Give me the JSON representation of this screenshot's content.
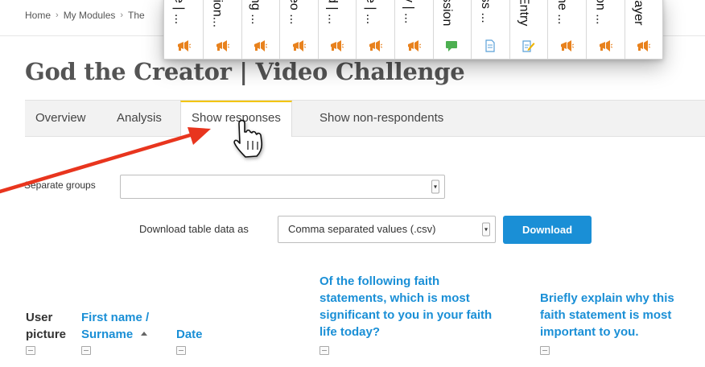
{
  "breadcrumb": [
    "Home",
    "My Modules",
    "The"
  ],
  "page_title": "God the Creator | Video Challenge",
  "popup_columns": [
    {
      "label": "e | ...",
      "icon": "megaphone-icon",
      "color": "#e8821e"
    },
    {
      "label": "tion...",
      "icon": "megaphone-icon",
      "color": "#e8821e"
    },
    {
      "label": "ng ...",
      "icon": "megaphone-icon",
      "color": "#e8821e"
    },
    {
      "label": "eo ...",
      "icon": "megaphone-icon",
      "color": "#e8821e"
    },
    {
      "label": "d | ...",
      "icon": "megaphone-icon",
      "color": "#e8821e"
    },
    {
      "label": "e | ...",
      "icon": "megaphone-icon",
      "color": "#e8821e"
    },
    {
      "label": "y | ...",
      "icon": "megaphone-icon",
      "color": "#e8821e"
    },
    {
      "label": "ssion",
      "icon": "chat-icon",
      "color": "#4caf50"
    },
    {
      "label": "ss ...",
      "icon": "document-icon",
      "color": "#5aa0d8"
    },
    {
      "label": "Entry",
      "icon": "edit-page-icon",
      "color": "#5aa0d8"
    },
    {
      "label": "he ...",
      "icon": "megaphone-icon",
      "color": "#e8821e"
    },
    {
      "label": "on ...",
      "icon": "megaphone-icon",
      "color": "#e8821e"
    },
    {
      "label": "rayer",
      "icon": "megaphone-icon",
      "color": "#e8821e"
    }
  ],
  "tabs": [
    {
      "label": "Overview"
    },
    {
      "label": "Analysis"
    },
    {
      "label": "Show responses",
      "active": true
    },
    {
      "label": "Show non-respondents"
    }
  ],
  "filters": {
    "groups_label": "Separate groups",
    "groups_value": "",
    "download_label": "Download table data as",
    "format_value": "Comma separated values (.csv)",
    "download_button": "Download"
  },
  "table": {
    "headers": {
      "user_picture": [
        "User",
        "picture"
      ],
      "name": {
        "first": "First name /",
        "surname": "Surname"
      },
      "date": "Date",
      "question1": [
        "Of the following faith",
        "statements, which is most",
        "significant to you in your faith",
        "life today?"
      ],
      "question2": [
        "Briefly explain why this",
        "faith statement is most",
        "important to you."
      ]
    }
  },
  "colors": {
    "link": "#1a8fd6",
    "tab_active_accent": "#f3c500",
    "arrow": "#e8351e",
    "button": "#1a8fd6"
  }
}
